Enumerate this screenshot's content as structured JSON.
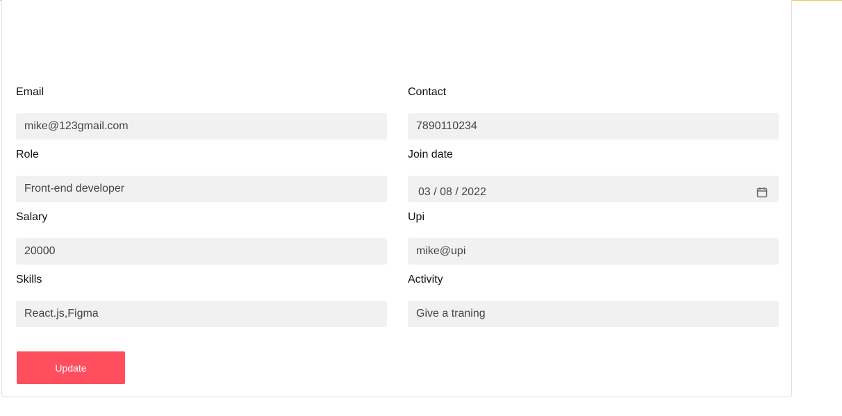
{
  "form": {
    "email": {
      "label": "Email",
      "value": "mike@123gmail.com"
    },
    "contact": {
      "label": "Contact",
      "value": "7890110234"
    },
    "role": {
      "label": "Role",
      "value": "Front-end developer"
    },
    "join_date": {
      "label": "Join date",
      "value": "03 / 08 / 2022"
    },
    "salary": {
      "label": "Salary",
      "value": "20000"
    },
    "upi": {
      "label": "Upi",
      "value": "mike@upi"
    },
    "skills": {
      "label": "Skills",
      "value": "React.js,Figma"
    },
    "activity": {
      "label": "Activity",
      "value": "Give a traning"
    },
    "update_label": "Update"
  },
  "colors": {
    "accent": "#ff4f5e",
    "input_background": "#f1f1f1",
    "top_rule": "#f2c94c"
  },
  "icons": {
    "join_date": "calendar-icon"
  }
}
